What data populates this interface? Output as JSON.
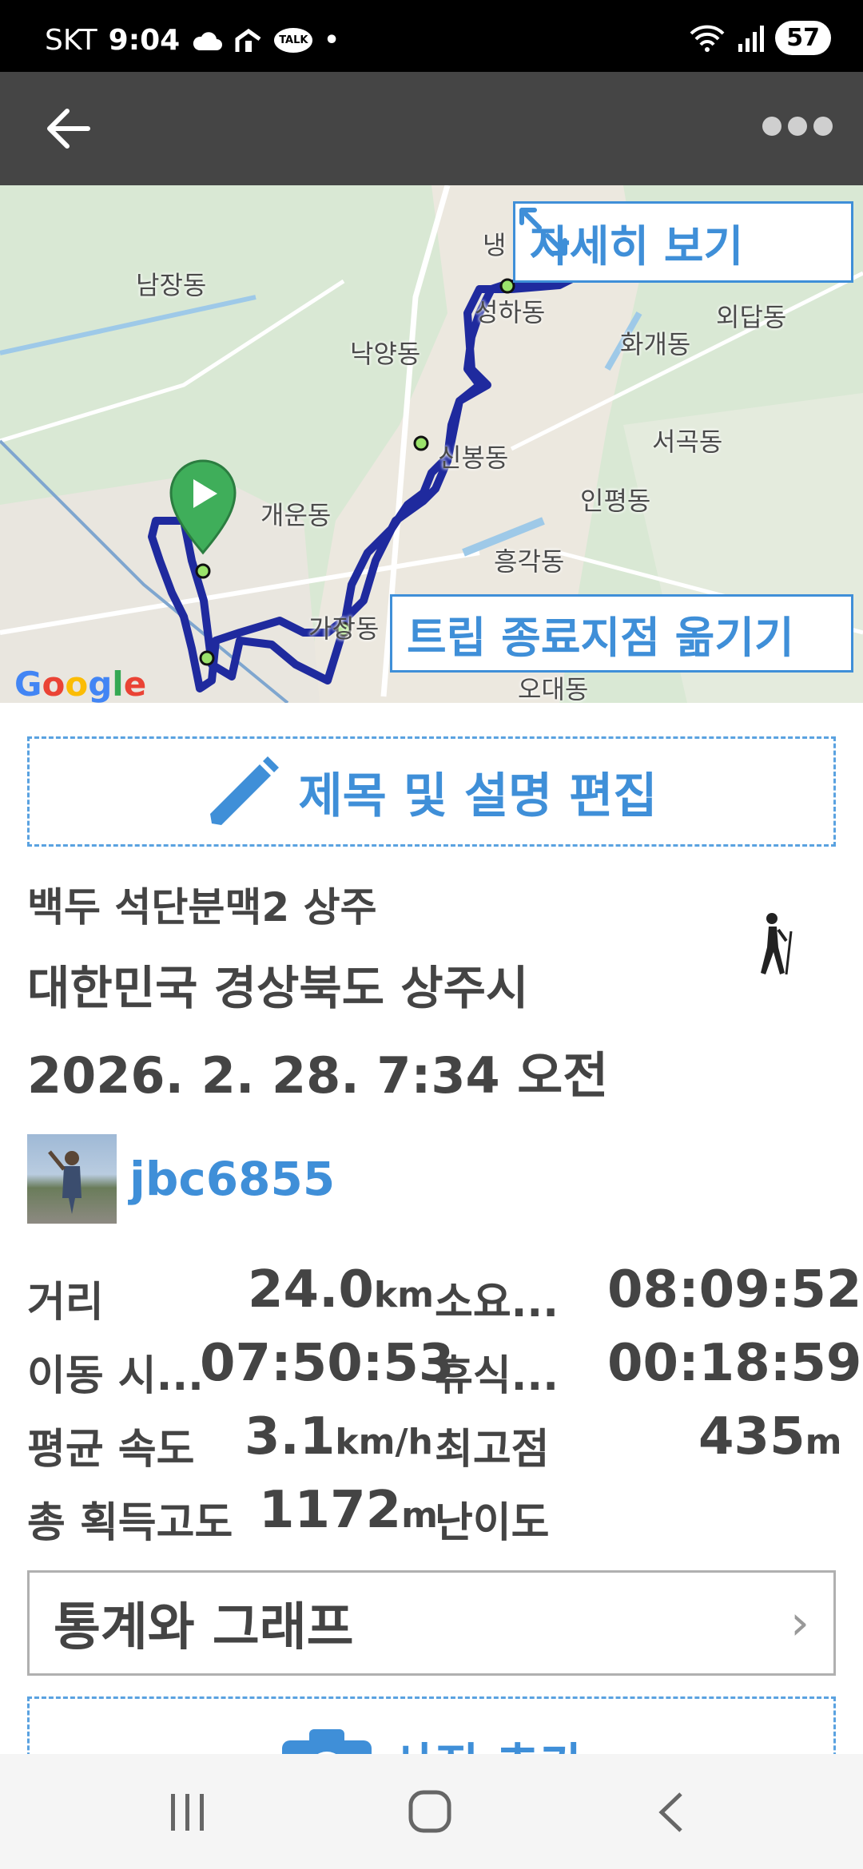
{
  "status_bar": {
    "carrier": "SKT",
    "time": "9:04",
    "battery": "57",
    "talk_badge": "TALK"
  },
  "map": {
    "labels": {
      "namjang": "남장동",
      "nakyang": "낙양동",
      "seongha": "성하동",
      "naeng": "냉",
      "hwagae": "화개동",
      "oedap": "외답동",
      "sinbong": "신봉동",
      "seogok": "서곡동",
      "inpyeong": "인평동",
      "gaeun": "개운동",
      "heunggak": "흥각동",
      "gajang": "가장동",
      "odae": "오대동"
    },
    "detail_button": "자세히 보기",
    "move_end_button": "트립 종료지점 옮기기",
    "google_logo": "Google",
    "route_color": "#1f2a9e"
  },
  "edit_button": "제목 및 설명 편집",
  "trip": {
    "subtitle": "백두 석단분맥2 상주",
    "region": "대한민국 경상북도 상주시",
    "date": "2026. 2. 28. 7:34 오전",
    "activity_icon": "hiking-icon",
    "username": "jbc6855"
  },
  "stats": {
    "distance_label": "거리",
    "distance_value": "24.0",
    "distance_unit": "km",
    "duration_label": "소요...",
    "duration_value": "08:09:52",
    "moving_label": "이동 시...",
    "moving_value": "07:50:53",
    "rest_label": "휴식...",
    "rest_value": "00:18:59",
    "avg_speed_label": "평균 속도",
    "avg_speed_value": "3.1",
    "avg_speed_unit": "km/h",
    "max_alt_label": "최고점",
    "max_alt_value": "435",
    "max_alt_unit": "m",
    "gain_label": "총 획득고도",
    "gain_value": "1172",
    "gain_unit": "m",
    "difficulty_label": "난이도"
  },
  "stats_graph_button": "통계와 그래프",
  "add_photo_button": "사진 추가"
}
